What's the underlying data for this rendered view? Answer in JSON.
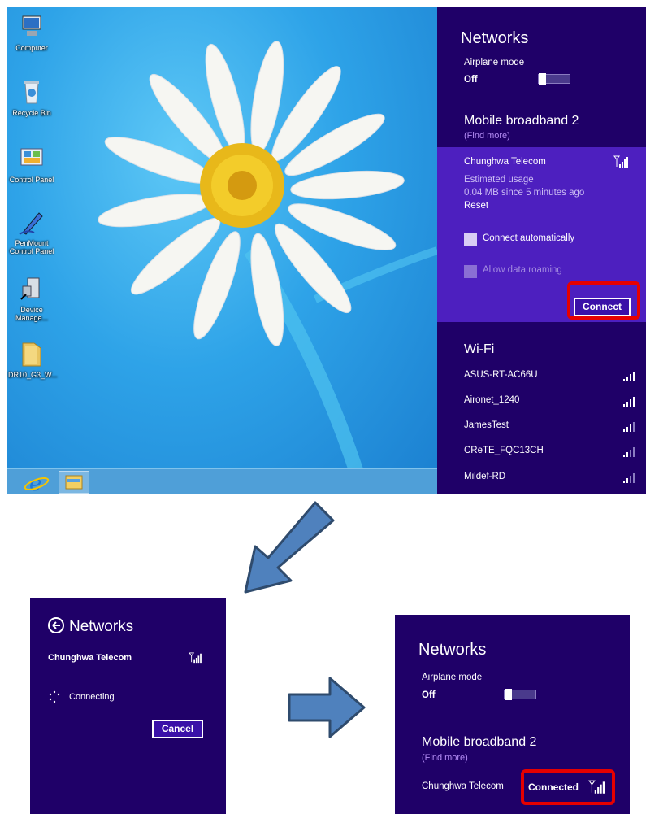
{
  "desktop": {
    "icons": [
      {
        "label": "Computer",
        "icon": "computer-icon"
      },
      {
        "label": "Recycle Bin",
        "icon": "recycle-bin-icon"
      },
      {
        "label": "Control Panel",
        "icon": "control-panel-icon"
      },
      {
        "label_line1": "PenMount",
        "label_line2": "Control Panel",
        "icon": "pen-icon"
      },
      {
        "label_line1": "Device",
        "label_line2": "Manage...",
        "icon": "device-manager-icon"
      },
      {
        "label": "DR10_G3_W...",
        "icon": "folder-icon"
      }
    ],
    "taskbar": [
      "internet-explorer-icon",
      "file-explorer-icon"
    ]
  },
  "networks_panel": {
    "title": "Networks",
    "airplane_label": "Airplane mode",
    "airplane_state": "Off",
    "mobile_section": "Mobile broadband 2",
    "find_more": "(Find more)",
    "carrier": "Chunghwa Telecom",
    "estimated_usage": "Estimated usage",
    "usage_value": "0.04 MB since 5 minutes ago",
    "reset": "Reset",
    "connect_auto": "Connect automatically",
    "allow_roaming": "Allow data roaming",
    "connect_button": "Connect",
    "wifi_section": "Wi-Fi",
    "wifi_networks": [
      "ASUS-RT-AC66U",
      "Aironet_1240",
      "JamesTest",
      "CReTE_FQC13CH",
      "Mildef-RD"
    ]
  },
  "connecting_panel": {
    "title": "Networks",
    "carrier": "Chunghwa Telecom",
    "status": "Connecting",
    "cancel_button": "Cancel"
  },
  "connected_panel": {
    "title": "Networks",
    "airplane_label": "Airplane mode",
    "airplane_state": "Off",
    "mobile_section": "Mobile broadband 2",
    "find_more": "(Find more)",
    "carrier": "Chunghwa Telecom",
    "status": "Connected"
  },
  "colors": {
    "panel_bg": "#1f0068",
    "selected_bg": "#4d1fbf",
    "highlight": "#e60000",
    "link": "#b48cf5",
    "arrow": "#4f81bd"
  }
}
